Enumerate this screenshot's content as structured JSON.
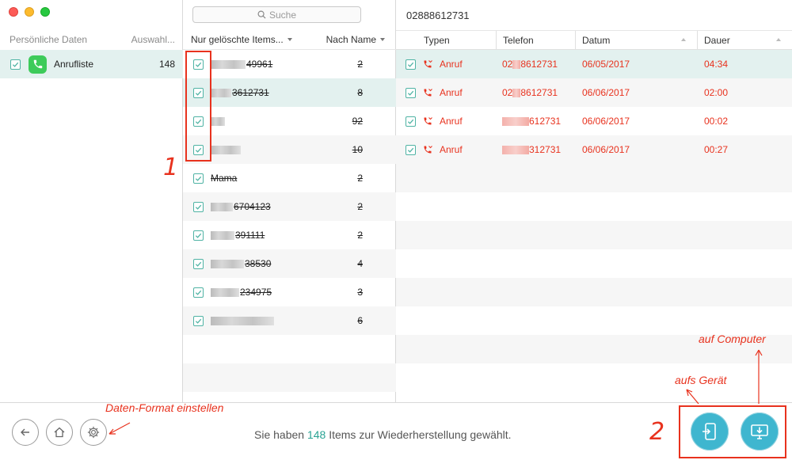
{
  "left": {
    "header_col1": "Persönliche Daten",
    "header_col2": "Auswahl...",
    "item": {
      "label": "Anrufliste",
      "count": "148",
      "icon": "phone-icon"
    }
  },
  "middle": {
    "search_placeholder": "Suche",
    "filter_label": "Nur gelöschte Items...",
    "sort_label": "Nach Name",
    "rows": [
      {
        "label_suffix": "49961",
        "count": "2"
      },
      {
        "label_suffix": "3612731",
        "count": "8"
      },
      {
        "label_suffix": "",
        "count": "92"
      },
      {
        "label_suffix": "",
        "count": "10"
      },
      {
        "label_suffix": "Mama",
        "count": "2"
      },
      {
        "label_suffix": "6704123",
        "count": "2"
      },
      {
        "label_suffix": "391111",
        "count": "2"
      },
      {
        "label_suffix": "38530",
        "count": "4"
      },
      {
        "label_suffix": "234975",
        "count": "3"
      },
      {
        "label_suffix": "",
        "count": "6"
      }
    ]
  },
  "right": {
    "title": "02888612731",
    "columns": {
      "types": "Typen",
      "phone": "Telefon",
      "date": "Datum",
      "duration": "Dauer"
    },
    "rows": [
      {
        "type": "Anruf",
        "phone_prefix": "02",
        "phone_suffix": "8612731",
        "date": "06/05/2017",
        "duration": "04:34"
      },
      {
        "type": "Anruf",
        "phone_prefix": "02",
        "phone_suffix": "8612731",
        "date": "06/06/2017",
        "duration": "02:00"
      },
      {
        "type": "Anruf",
        "phone_prefix": "",
        "phone_suffix": "612731",
        "date": "06/06/2017",
        "duration": "00:02"
      },
      {
        "type": "Anruf",
        "phone_prefix": "",
        "phone_suffix": "312731",
        "date": "06/06/2017",
        "duration": "00:27"
      }
    ]
  },
  "bottom": {
    "status_prefix": "Sie haben ",
    "status_count": "148",
    "status_suffix": " Items zur Wiederherstellung gewählt."
  },
  "annotations": {
    "label_1": "1",
    "label_2": "2",
    "data_format": "Daten-Format einstellen",
    "to_device": "aufs Gerät",
    "to_computer": "auf Computer"
  },
  "colors": {
    "accent": "#2aa394",
    "selection": "#e3f1ef",
    "deleted_red": "#e8321e",
    "action_blue": "#3fb6cf"
  }
}
